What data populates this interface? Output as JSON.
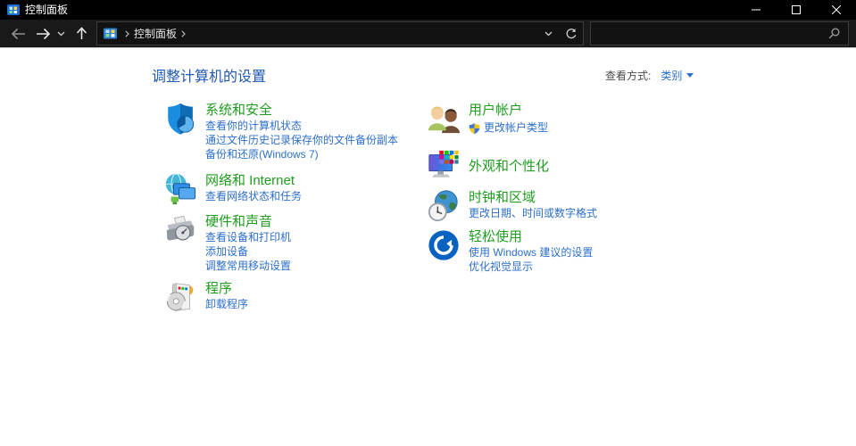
{
  "window": {
    "title": "控制面板"
  },
  "navbar": {
    "breadcrumb": {
      "root": "控制面板"
    },
    "search": {
      "value": ""
    }
  },
  "main": {
    "heading": "调整计算机的设置",
    "view_by": {
      "label": "查看方式:",
      "value": "类别"
    },
    "left_column": [
      {
        "title": "系统和安全",
        "links": [
          "查看你的计算机状态",
          "通过文件历史记录保存你的文件备份副本",
          "备份和还原(Windows 7)"
        ]
      },
      {
        "title": "网络和 Internet",
        "links": [
          "查看网络状态和任务"
        ]
      },
      {
        "title": "硬件和声音",
        "links": [
          "查看设备和打印机",
          "添加设备",
          "调整常用移动设置"
        ]
      },
      {
        "title": "程序",
        "links": [
          "卸载程序"
        ]
      }
    ],
    "right_column": [
      {
        "title": "用户帐户",
        "links": [
          "更改帐户类型"
        ]
      },
      {
        "title": "外观和个性化",
        "links": []
      },
      {
        "title": "时钟和区域",
        "links": [
          "更改日期、时间或数字格式"
        ]
      },
      {
        "title": "轻松使用",
        "links": [
          "使用 Windows 建议的设置",
          "优化视觉显示"
        ]
      }
    ]
  },
  "colors": {
    "chrome_black": "#000000",
    "navbar_dark": "#191919",
    "content_white": "#ffffff",
    "category_title_green": "#1f9d1f",
    "link_blue": "#2d6fc9",
    "heading_blue": "#2257ae"
  }
}
